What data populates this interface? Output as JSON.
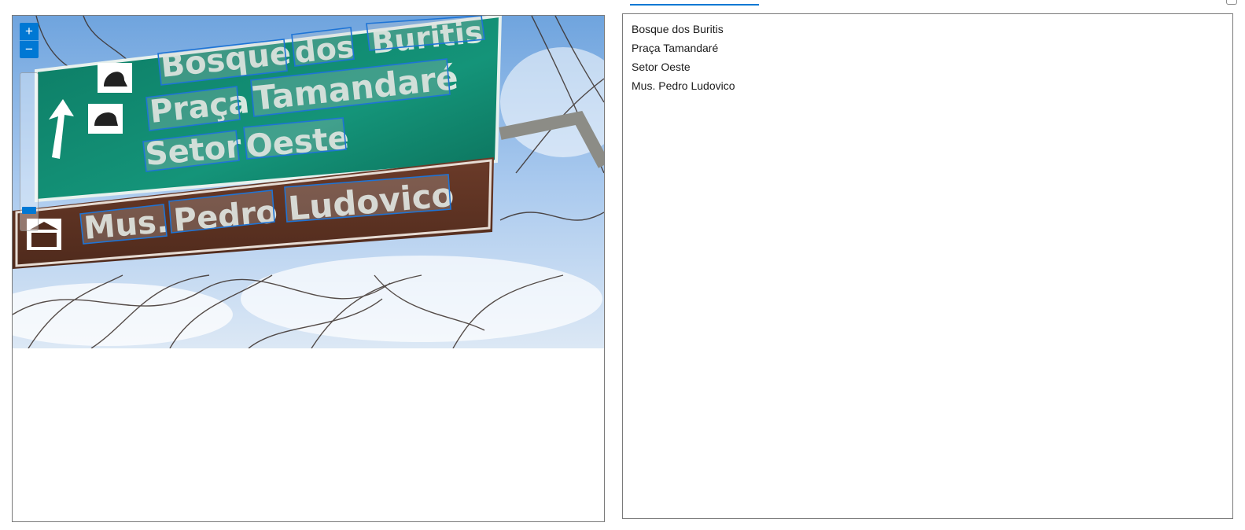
{
  "tabs": {
    "active_underline_color": "#0078d4"
  },
  "viewer": {
    "zoom_in_label": "+",
    "zoom_out_label": "−",
    "accent_color": "#0078d4",
    "zoom_level_fraction": 0.9,
    "detected_words": [
      "Bosque",
      "dos",
      "Buritis",
      "Praça",
      "Tamandaré",
      "Setor",
      "Oeste",
      "Mus.",
      "Pedro",
      "Ludovico"
    ]
  },
  "results": {
    "lines": [
      "Bosque dos Buritis",
      "Praça Tamandaré",
      "Setor Oeste",
      "Mus. Pedro Ludovico"
    ]
  }
}
